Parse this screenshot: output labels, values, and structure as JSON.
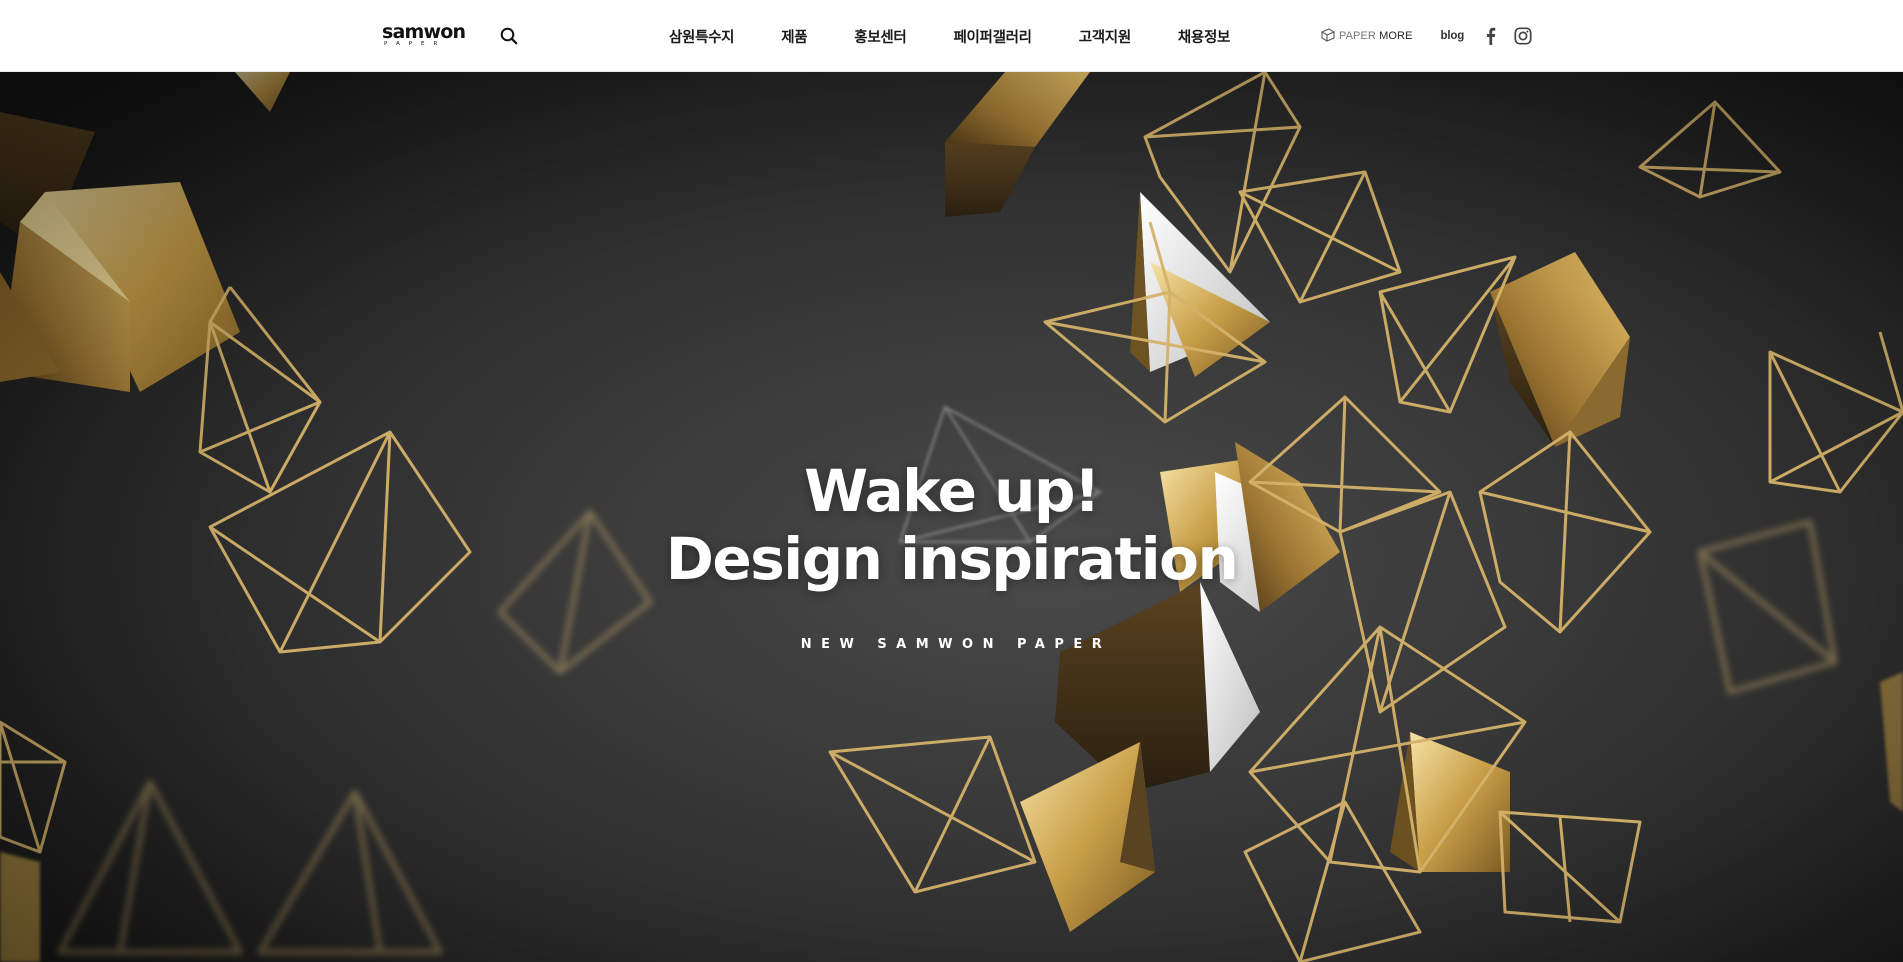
{
  "header": {
    "logo": {
      "word": "samwon",
      "sub": "PAPER",
      "icon": "samwon-logo"
    },
    "search_icon": "search-icon",
    "nav": [
      {
        "label": "삼원특수지"
      },
      {
        "label": "제품"
      },
      {
        "label": "홍보센터"
      },
      {
        "label": "페이퍼갤러리"
      },
      {
        "label": "고객지원"
      },
      {
        "label": "채용정보"
      }
    ],
    "utils": {
      "paper_more_prefix": "PAPER",
      "paper_more_suffix": "MORE",
      "paper_more_icon": "paper-more-icon",
      "blog_label": "blog",
      "facebook_icon": "facebook-icon",
      "instagram_icon": "instagram-icon"
    }
  },
  "hero": {
    "title_line1": "Wake up!",
    "title_line2": "Design inspiration",
    "subtitle": "NEW SAMWON PAPER",
    "background_icon": "gold-pyramids-artwork"
  },
  "colors": {
    "header_bg": "#ffffff",
    "nav_text": "#1a1a1a",
    "hero_bg": "#2b2b2b",
    "gold": "#c9a24a",
    "gold_light": "#f0d78c",
    "hero_text": "#ffffff"
  }
}
